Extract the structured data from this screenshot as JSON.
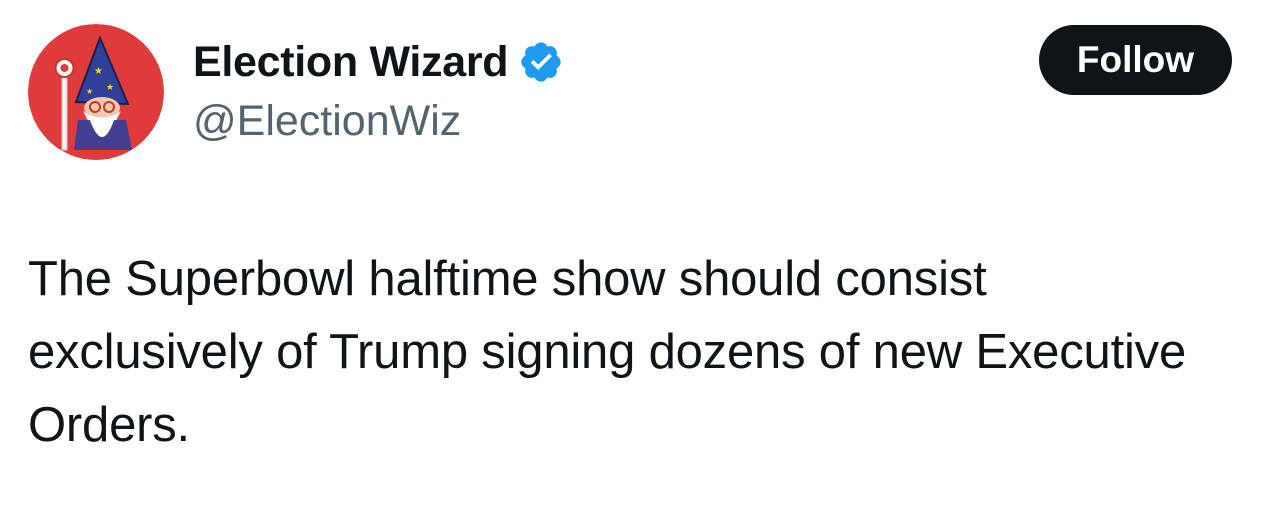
{
  "author": {
    "display_name": "Election Wizard",
    "handle": "@ElectionWiz",
    "verified_icon": "verified-badge-icon",
    "avatar_icon": "wizard-avatar-icon"
  },
  "actions": {
    "follow_label": "Follow"
  },
  "tweet": {
    "text": "The Superbowl halftime show should consist exclusively of Trump signing dozens of new Executive Orders."
  },
  "colors": {
    "text_primary": "#0f1419",
    "text_secondary": "#536471",
    "verified_blue": "#1d9bf0",
    "follow_bg": "#0f1419",
    "avatar_bg": "#e03a3a"
  }
}
